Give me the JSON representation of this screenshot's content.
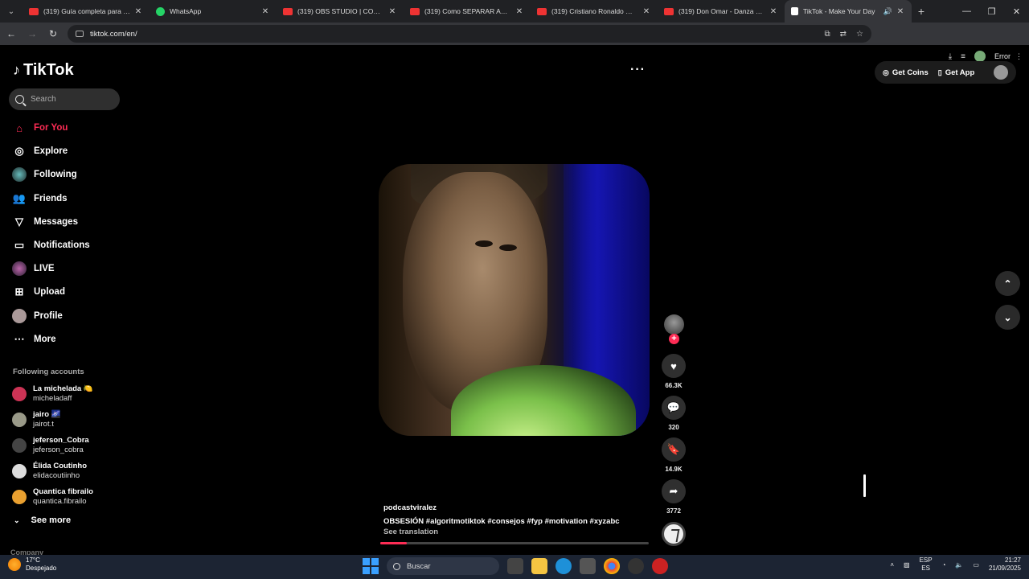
{
  "browser": {
    "tabs": [
      {
        "title": "(319) Guía completa para hacer",
        "icon": "youtube-icon"
      },
      {
        "title": "WhatsApp",
        "icon": "whatsapp-icon"
      },
      {
        "title": "(319) OBS STUDIO | CONFIGUR",
        "icon": "youtube-icon"
      },
      {
        "title": "(319) Como SEPARAR AUDIOS",
        "icon": "youtube-icon"
      },
      {
        "title": "(319) Cristiano Ronaldo ← \"DA",
        "icon": "youtube-icon"
      },
      {
        "title": "(319) Don Omar - Danza Kudur",
        "icon": "youtube-icon"
      },
      {
        "title": "TikTok - Make Your Day",
        "icon": "tiktok-icon",
        "active": true
      }
    ],
    "url": "tiktok.com/en/",
    "error_label": "Error"
  },
  "tiktok": {
    "logo_text": "TikTok",
    "search_placeholder": "Search",
    "nav": [
      {
        "label": "For You",
        "icon": "home-icon",
        "active": true
      },
      {
        "label": "Explore",
        "icon": "compass-icon"
      },
      {
        "label": "Following",
        "icon": "following-icon"
      },
      {
        "label": "Friends",
        "icon": "friends-icon"
      },
      {
        "label": "Messages",
        "icon": "send-icon"
      },
      {
        "label": "Notifications",
        "icon": "inbox-icon"
      },
      {
        "label": "LIVE",
        "icon": "live-icon"
      },
      {
        "label": "Upload",
        "icon": "plus-square-icon"
      },
      {
        "label": "Profile",
        "icon": "avatar-icon"
      },
      {
        "label": "More",
        "icon": "more-dots-icon"
      }
    ],
    "following_title": "Following accounts",
    "following_accounts": [
      {
        "name": "La michelada 🍋",
        "handle": "micheladaff"
      },
      {
        "name": "jairo 🌌",
        "handle": "jairot.t"
      },
      {
        "name": "jeferson_Cobra",
        "handle": "jeferson_cobra"
      },
      {
        "name": "Élida Coutinho",
        "handle": "elidacoutiinho"
      },
      {
        "name": "Quantica fibrailo",
        "handle": "quantica.fibrailo"
      }
    ],
    "see_more": "See more",
    "company": "Company",
    "top_right": {
      "coins": "Get Coins",
      "app": "Get App"
    },
    "video": {
      "username": "podcastviralez",
      "description": "OBSESIÓN #algoritmotiktok #consejos #fyp #motivation #xyzabc",
      "see_translation": "See translation",
      "progress": 0.1
    },
    "actions": {
      "likes": "66.3K",
      "comments": "320",
      "saves": "14.9K",
      "shares": "3772"
    }
  },
  "taskbar": {
    "weather_temp": "17°C",
    "weather_desc": "Despejado",
    "search": "Buscar",
    "lang_top": "ESP",
    "lang_bottom": "ES",
    "time": "21:27",
    "date": "21/09/2025"
  }
}
